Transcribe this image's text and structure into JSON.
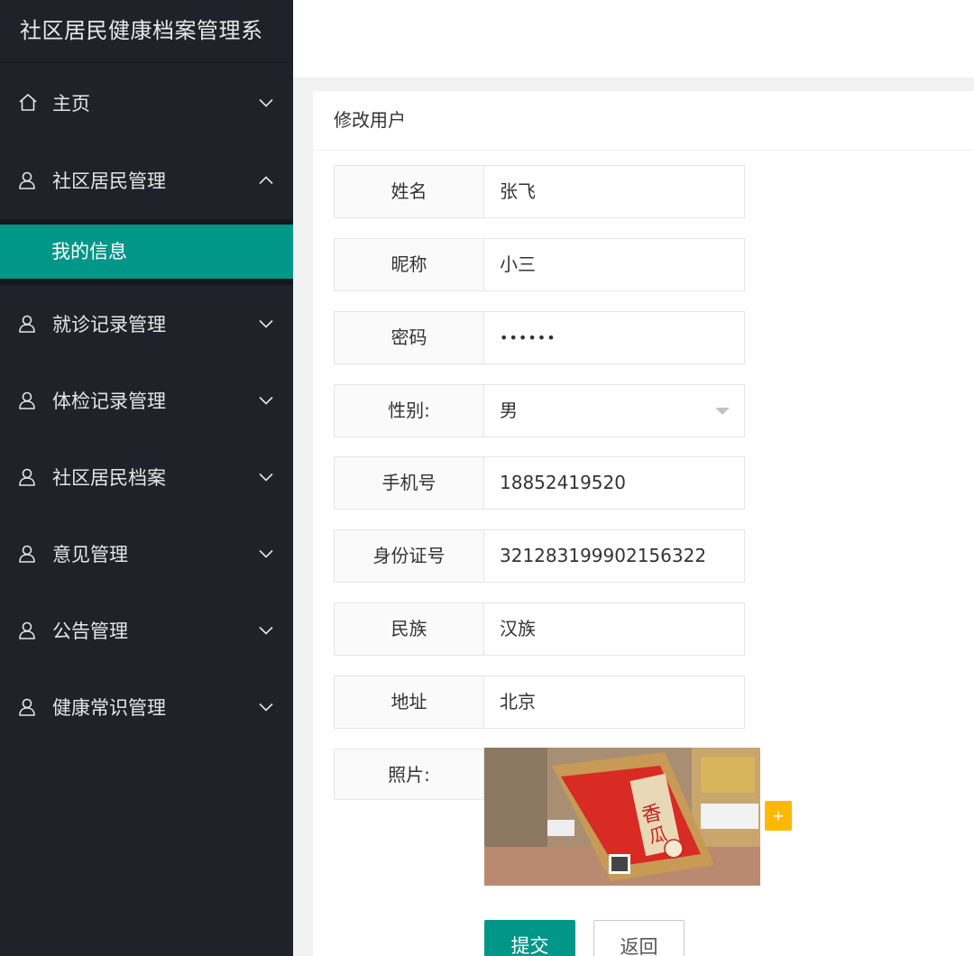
{
  "app": {
    "title": "社区居民健康档案管理系"
  },
  "sidebar": {
    "items": [
      {
        "label": "主页",
        "icon": "home-icon",
        "state": "collapsed"
      },
      {
        "label": "社区居民管理",
        "icon": "user-icon",
        "state": "expanded",
        "children": [
          {
            "label": "我的信息",
            "active": true
          }
        ]
      },
      {
        "label": "就诊记录管理",
        "icon": "user-icon",
        "state": "collapsed"
      },
      {
        "label": "体检记录管理",
        "icon": "user-icon",
        "state": "collapsed"
      },
      {
        "label": "社区居民档案",
        "icon": "user-icon",
        "state": "collapsed"
      },
      {
        "label": "意见管理",
        "icon": "user-icon",
        "state": "collapsed"
      },
      {
        "label": "公告管理",
        "icon": "user-icon",
        "state": "collapsed"
      },
      {
        "label": "健康常识管理",
        "icon": "user-icon",
        "state": "collapsed"
      }
    ]
  },
  "form": {
    "title": "修改用户",
    "fields": {
      "name": {
        "label": "姓名",
        "value": "张飞"
      },
      "nickname": {
        "label": "昵称",
        "value": "小三"
      },
      "password": {
        "label": "密码",
        "value": "••••••"
      },
      "gender": {
        "label": "性别:",
        "value": "男"
      },
      "phone": {
        "label": "手机号",
        "value": "18852419520"
      },
      "id_card": {
        "label": "身份证号",
        "value": "321283199902156322"
      },
      "ethnicity": {
        "label": "民族",
        "value": "汉族"
      },
      "address": {
        "label": "地址",
        "value": "北京"
      },
      "photo": {
        "label": "照片:"
      }
    },
    "upload_label": "+",
    "submit_label": "提交",
    "back_label": "返回"
  },
  "colors": {
    "sidebar_bg": "#20222a",
    "accent": "#009688",
    "upload_accent": "#ffb800"
  }
}
